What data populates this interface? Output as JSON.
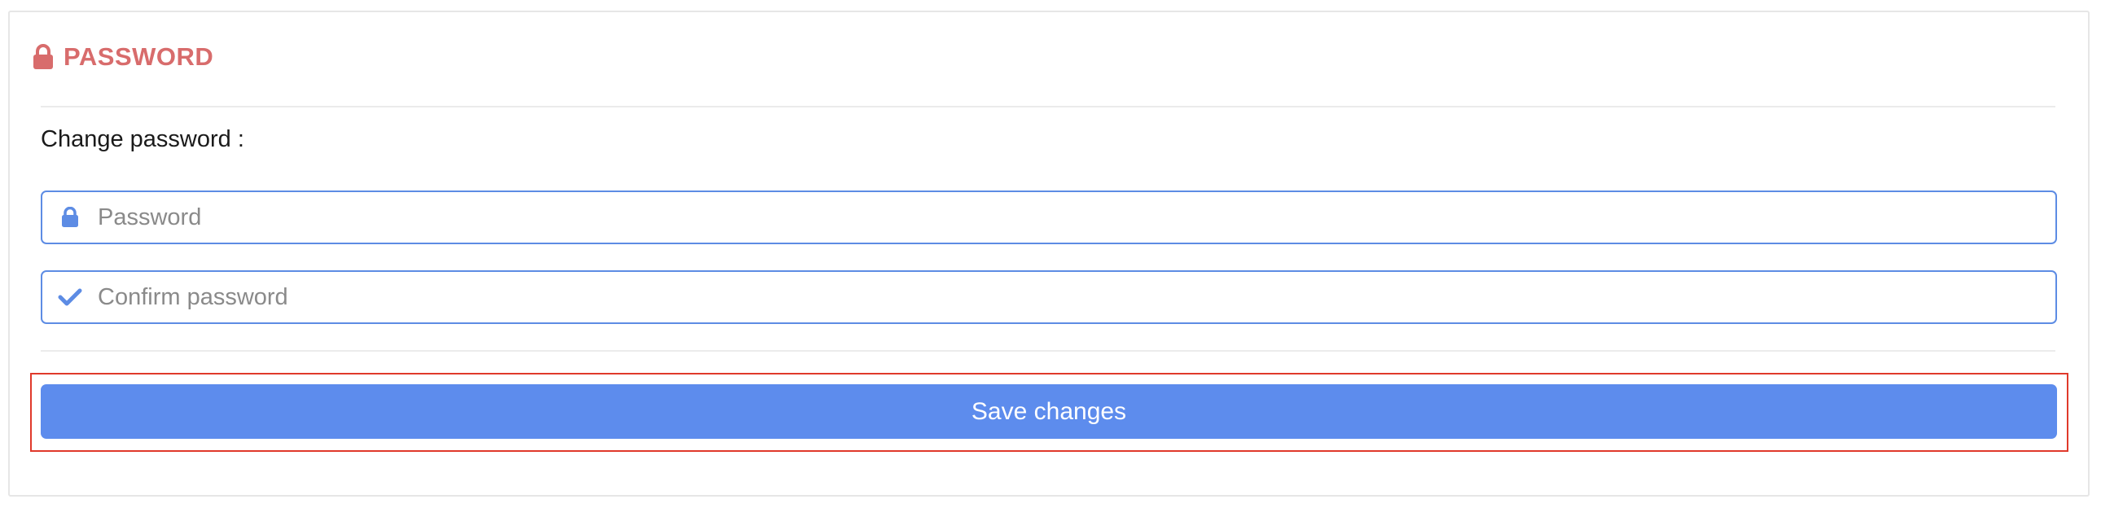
{
  "section": {
    "title": "PASSWORD",
    "icon": "lock-icon",
    "accent_color": "#d86c6c"
  },
  "form": {
    "label": "Change password :",
    "password": {
      "placeholder": "Password",
      "value": "",
      "icon": "lock-icon"
    },
    "confirm_password": {
      "placeholder": "Confirm password",
      "value": "",
      "icon": "check-icon"
    },
    "input_border_color": "#5d8ce4"
  },
  "actions": {
    "save_label": "Save changes",
    "save_color": "#5d8ced",
    "highlight_color": "#e0392b"
  }
}
